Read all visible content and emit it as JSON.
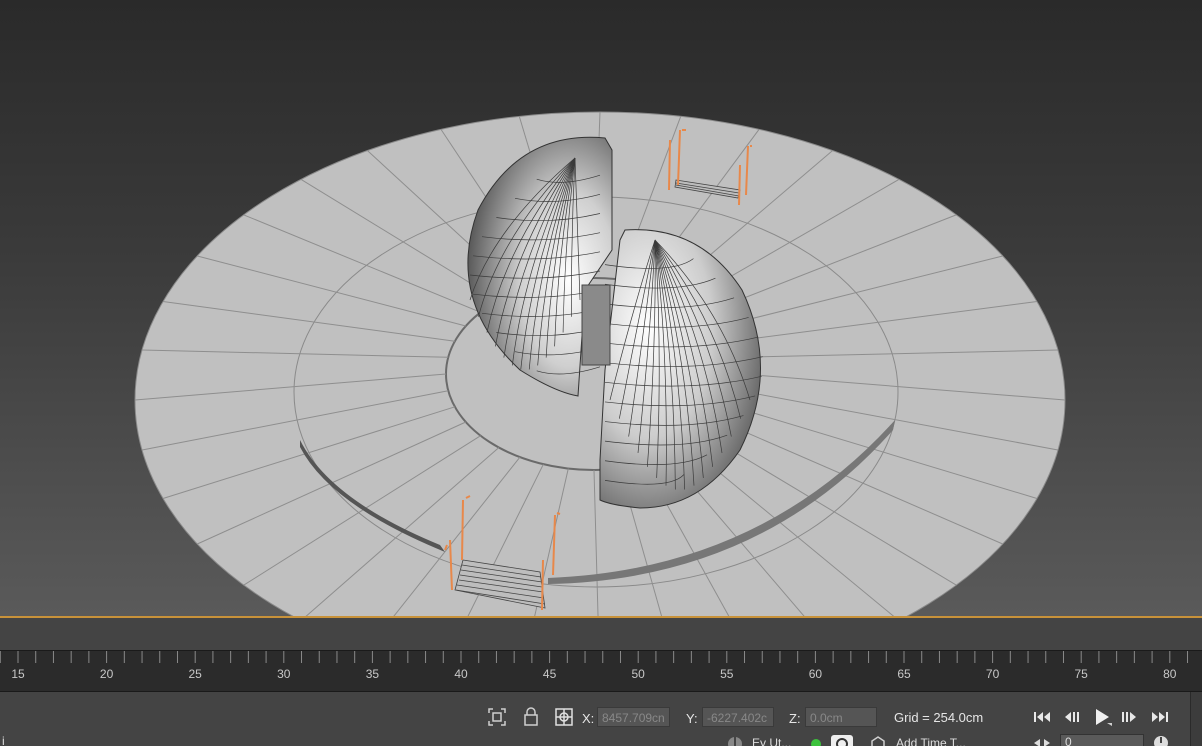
{
  "timeline": {
    "labels": [
      "15",
      "20",
      "25",
      "30",
      "35",
      "40",
      "45",
      "50",
      "55",
      "60",
      "65",
      "70",
      "75",
      "80"
    ]
  },
  "coords": {
    "x_label": "X:",
    "x_value": "8457.709cn",
    "y_label": "Y:",
    "y_value": "-6227.402c",
    "z_label": "Z:",
    "z_value": "0.0cm"
  },
  "grid_text": "Grid = 254.0cm",
  "bottom": {
    "frame_value": "0",
    "partial_left": "Ey Ut...",
    "partial_mid": "Add Time T...",
    "left_fragment": "i"
  },
  "colors": {
    "viewport_border": "#c8923a",
    "helper_orange": "#e8884a",
    "status_green": "#3cc23c"
  },
  "icons": [
    "isolate-icon",
    "lock-icon",
    "absolute-mode-icon",
    "go-to-start-icon",
    "previous-frame-icon",
    "play-icon",
    "next-frame-icon",
    "go-to-end-icon"
  ]
}
